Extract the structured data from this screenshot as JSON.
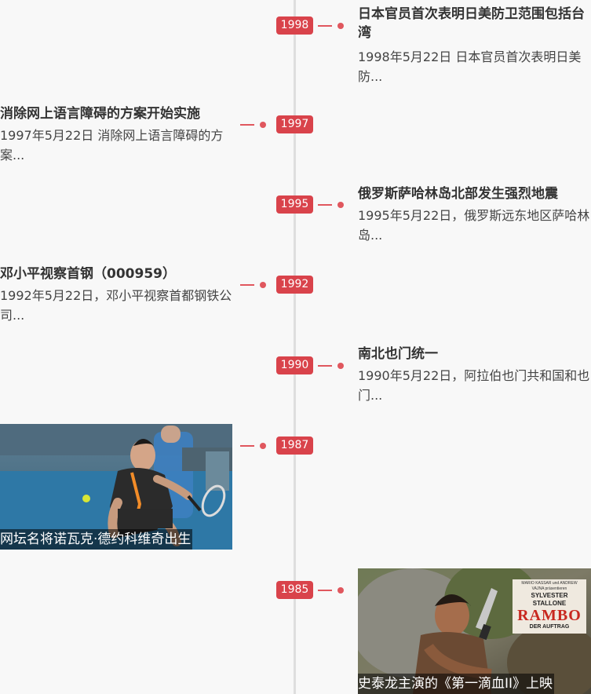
{
  "timeline": [
    {
      "year": "1998",
      "side": "right",
      "title": "日本官员首次表明日美防卫范围包括台湾",
      "summary": "1998年5月22日 日本官员首次表明日美防..."
    },
    {
      "year": "1997",
      "side": "left",
      "title": "消除网上语言障碍的方案开始实施",
      "summary": "1997年5月22日 消除网上语言障碍的方案..."
    },
    {
      "year": "1995",
      "side": "right",
      "title": "俄罗斯萨哈林岛北部发生强烈地震",
      "summary": "1995年5月22日，俄罗斯远东地区萨哈林岛..."
    },
    {
      "year": "1992",
      "side": "left",
      "title": "邓小平视察首钢（000959）",
      "summary": "1992年5月22日，邓小平视察首都钢铁公司..."
    },
    {
      "year": "1990",
      "side": "right",
      "title": "南北也门统一",
      "summary": "1990年5月22日，阿拉伯也门共和国和也门..."
    },
    {
      "year": "1987",
      "side": "left",
      "caption": "网坛名将诺瓦克·德约科维奇出生"
    },
    {
      "year": "1985",
      "side": "right",
      "caption": "史泰龙主演的《第一滴血II》上映",
      "poster": {
        "top_line": "MARIO KASSAR und ANDREW VAJNA präsentieren",
        "star": "SYLVESTER STALLONE",
        "title": "RAMBO",
        "subtitle": "DER AUFTRAG"
      }
    }
  ],
  "colors": {
    "accent": "#d9434b",
    "axis": "#dedede",
    "background": "#f8f8f8"
  }
}
